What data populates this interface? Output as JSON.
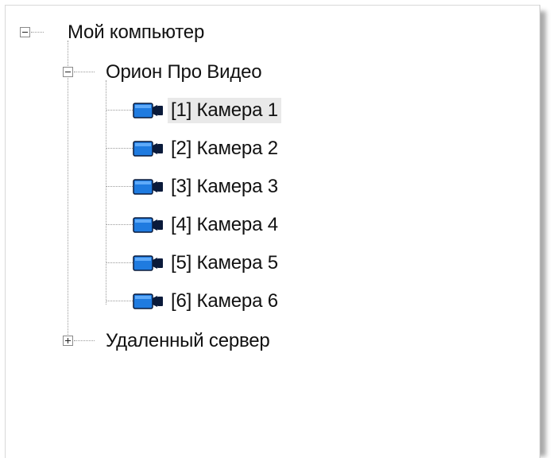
{
  "tree": {
    "root": {
      "label": "Мой компьютер",
      "expanded": true
    },
    "group": {
      "label": "Орион Про Видео",
      "expanded": true,
      "icon": "camera-icon",
      "items": [
        {
          "label": "[1] Камера 1",
          "selected": true
        },
        {
          "label": "[2] Камера 2",
          "selected": false
        },
        {
          "label": "[3] Камера 3",
          "selected": false
        },
        {
          "label": "[4] Камера 4",
          "selected": false
        },
        {
          "label": "[5] Камера 5",
          "selected": false
        },
        {
          "label": "[6] Камера 6",
          "selected": false
        }
      ]
    },
    "remote": {
      "label": "Удаленный сервер",
      "expanded": false
    }
  },
  "colors": {
    "camera_body": "#1f7be0",
    "camera_dark": "#0a1a3a",
    "selection": "#e9e9e9"
  }
}
